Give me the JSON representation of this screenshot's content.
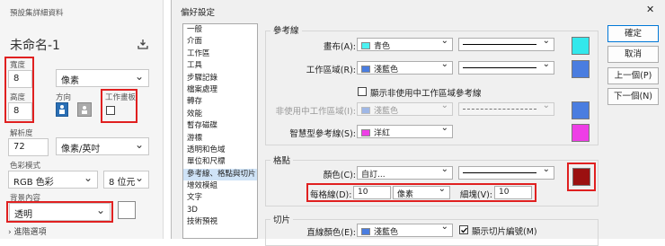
{
  "left": {
    "section_label": "預設集詳細資料",
    "doc_name": "未命名-1",
    "width_label": "寬度",
    "width_value": "8",
    "unit_value": "像素",
    "height_label": "高度",
    "height_value": "8",
    "orientation_label": "方向",
    "artboard_label": "工作畫板",
    "resolution_label": "解析度",
    "resolution_value": "72",
    "resolution_unit": "像素/英吋",
    "color_mode_label": "色彩模式",
    "color_mode_value": "RGB 色彩",
    "bit_depth_value": "8 位元",
    "background_label": "背景內容",
    "background_value": "透明",
    "advanced_label": "進階選項"
  },
  "dialog": {
    "title": "偏好設定",
    "close_glyph": "✕",
    "categories": [
      {
        "label": "一般",
        "selected": false
      },
      {
        "label": "介面",
        "selected": false
      },
      {
        "label": "工作區",
        "selected": false
      },
      {
        "label": "工具",
        "selected": false
      },
      {
        "label": "步驟記錄",
        "selected": false
      },
      {
        "label": "檔案處理",
        "selected": false
      },
      {
        "label": "轉存",
        "selected": false
      },
      {
        "label": "效能",
        "selected": false
      },
      {
        "label": "暫存磁碟",
        "selected": false
      },
      {
        "label": "游標",
        "selected": false
      },
      {
        "label": "透明和色域",
        "selected": false
      },
      {
        "label": "單位和尺標",
        "selected": false
      },
      {
        "label": "參考線、格點與切片",
        "selected": true
      },
      {
        "label": "增效模組",
        "selected": false
      },
      {
        "label": "文字",
        "selected": false
      },
      {
        "label": "3D",
        "selected": false
      },
      {
        "label": "技術預視",
        "selected": false
      }
    ],
    "guides": {
      "group_label": "參考線",
      "canvas_label": "畫布(A):",
      "canvas_color": "青色",
      "canvas_swatch": "#4df2f2",
      "canvas_chip": "#33e8ec",
      "artboard_label": "工作區域(R):",
      "artboard_color": "淺藍色",
      "artboard_swatch": "#4a7de0",
      "show_inactive_label": "顯示非使用中工作區域參考線",
      "inactive_label": "非使用中工作區域(I):",
      "inactive_color": "淺藍色",
      "smart_label": "智慧型參考線(S):",
      "smart_color": "洋紅",
      "smart_swatch": "#ee3ee6"
    },
    "grid": {
      "group_label": "格點",
      "color_label": "顏色(C):",
      "color_value": "自訂...",
      "color_swatch": "#9b1010",
      "every_label": "每格線(D):",
      "every_value": "10",
      "every_unit": "像素",
      "subdiv_label": "細塊(V):",
      "subdiv_value": "10"
    },
    "slices": {
      "group_label": "切片",
      "line_color_label": "直線顏色(E):",
      "line_color_value": "淺藍色",
      "show_numbers_label": "顯示切片編號(M)"
    },
    "buttons": {
      "ok": "確定",
      "cancel": "取消",
      "prev": "上一個(P)",
      "next": "下一個(N)"
    }
  }
}
